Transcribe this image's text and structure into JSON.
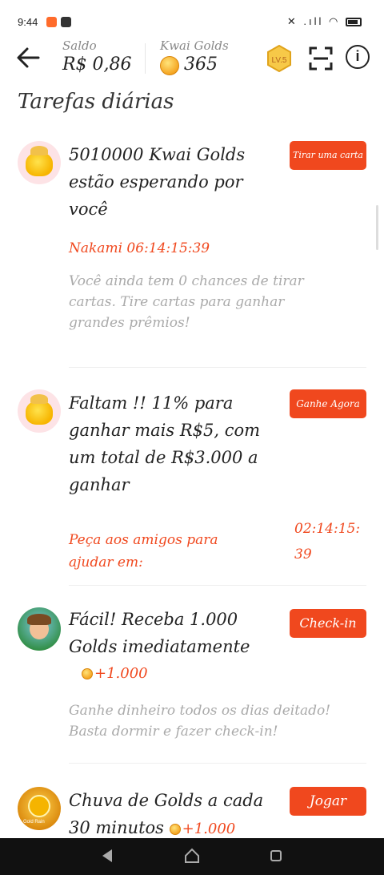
{
  "status_bar": {
    "time": "9:44",
    "icons": "✕ .ıll ◠"
  },
  "header": {
    "saldo_label": "Saldo",
    "saldo_value": "R$ 0,86",
    "golds_label": "Kwai Golds",
    "golds_value": "365",
    "level_badge": "LV.5"
  },
  "section_title": "Tarefas diárias",
  "tasks": [
    {
      "title_lines": [
        "5010000 Kwai Golds",
        "estão esperando por",
        "você"
      ],
      "button": "Tirar uma carta",
      "countdown": "Nakami 06:14:15:39",
      "description_lines": [
        "Você ainda tem 0 chances de tirar",
        "cartas. Tire cartas para ganhar",
        "grandes prêmios!"
      ]
    },
    {
      "title_lines": [
        "Faltam !! 11% para",
        "ganhar mais R$5, com",
        "um total de R$3.000 a",
        "ganhar"
      ],
      "button": "Ganhe Agora",
      "help_lines": [
        "Peça aos amigos para",
        "ajudar em:"
      ],
      "timer_lines": [
        "02:14:15:",
        "39"
      ]
    },
    {
      "title_lines": [
        "Fácil! Receba 1.000",
        "Golds imediatamente"
      ],
      "button": "Check-in",
      "reward": "+1.000",
      "description_lines": [
        "Ganhe dinheiro todos os dias deitado!",
        "Basta dormir e fazer check-in!"
      ]
    },
    {
      "title_lines": [
        "Chuva de Golds a cada",
        "30 minutos"
      ],
      "button": "Jogar",
      "reward": "+1.000",
      "avatar_text": "Gold Rain"
    }
  ],
  "colors": {
    "accent": "#f0481e",
    "muted_text": "#aaaaaa"
  }
}
